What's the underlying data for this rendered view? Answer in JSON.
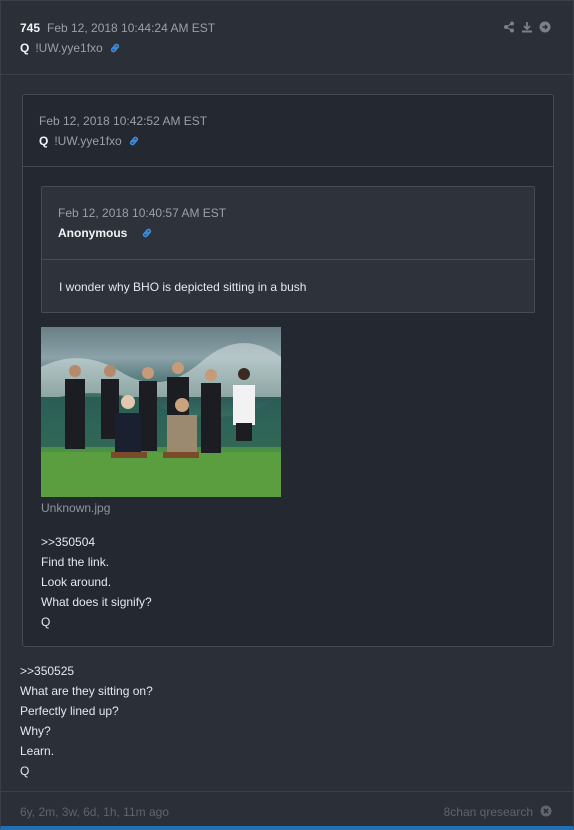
{
  "post": {
    "number": "745",
    "date": "Feb 12, 2018 10:44:24 AM EST",
    "author": "Q",
    "tripcode": "!UW.yye1fxo",
    "icons": [
      "share-icon",
      "download-icon",
      "arrow-right-circle-icon"
    ],
    "lines": [
      ">>350525",
      "What are they sitting on?",
      "Perfectly lined up?",
      "Why?",
      "Learn.",
      "Q"
    ]
  },
  "quote1": {
    "date": "Feb 12, 2018 10:42:52 AM EST",
    "author": "Q",
    "tripcode": "!UW.yye1fxo",
    "image_filename": "Unknown.jpg",
    "lines": [
      ">>350504",
      "Find the link.",
      "Look around.",
      "What does it signify?",
      "Q"
    ]
  },
  "quote2": {
    "date": "Feb 12, 2018 10:40:57 AM EST",
    "author": "Anonymous",
    "message": "I wonder why BHO is depicted sitting in a bush"
  },
  "footer": {
    "age": "6y, 2m, 3w, 6d, 1h, 11m ago",
    "board": "8chan qresearch",
    "close_icon": "close-circle-icon"
  },
  "colors": {
    "accent": "#1f6fb5",
    "link": "#3d8ee0",
    "background": "#2a2f38"
  }
}
